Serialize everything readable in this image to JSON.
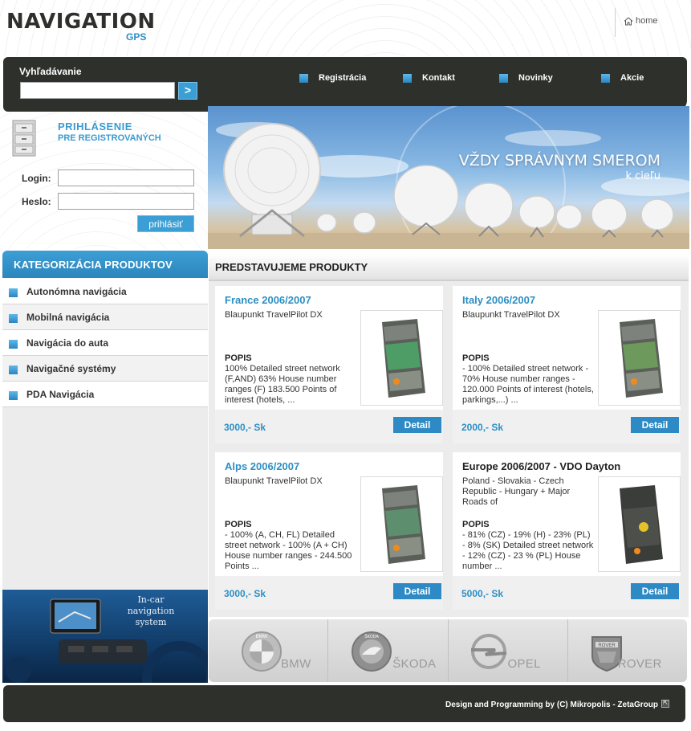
{
  "header": {
    "logo_title": "NAVIGATION",
    "logo_sub": "GPS",
    "home_label": "home"
  },
  "search": {
    "label": "Vyhľadávanie",
    "value": "",
    "placeholder": "",
    "button_label": ">"
  },
  "topnav": {
    "items": [
      {
        "label": "Registrácia"
      },
      {
        "label": "Kontakt"
      },
      {
        "label": "Novinky"
      },
      {
        "label": "Akcie"
      }
    ]
  },
  "login": {
    "title": "PRIHLÁSENIE",
    "subtitle": "PRE REGISTROVANÝCH",
    "login_label": "Login:",
    "password_label": "Heslo:",
    "login_value": "",
    "password_value": "",
    "button_label": "prihlásiť"
  },
  "banner": {
    "title": "VŽDY SPRÁVNYM SMEROM",
    "subtitle": "k cieľu"
  },
  "categories": {
    "title": "KATEGORIZÁCIA PRODUKTOV",
    "items": [
      {
        "label": "Autonómna navigácia"
      },
      {
        "label": "Mobilná navigácia"
      },
      {
        "label": "Navigácia do auta"
      },
      {
        "label": "Navigačné systémy"
      },
      {
        "label": "PDA Navigácia"
      }
    ]
  },
  "incar": {
    "line1": "In-car",
    "line2": "navigation",
    "line3": "system"
  },
  "products": {
    "title": "PREDSTAVUJEME PRODUKTY",
    "items": [
      {
        "title": "France 2006/2007",
        "subtitle": "Blaupunkt TravelPilot DX",
        "popis_label": "POPIS",
        "description": "100% Detailed street network (F,AND) 63% House number ranges (F) 183.500 Points of interest (hotels, ...",
        "price": "3000,- Sk",
        "button_label": "Detail"
      },
      {
        "title": "Italy 2006/2007",
        "subtitle": "Blaupunkt TravelPilot DX",
        "popis_label": "POPIS",
        "description": "- 100% Detailed street network - 70% House number ranges - 120.000 Points of interest (hotels, parkings,...) ...",
        "price": "2000,- Sk",
        "button_label": "Detail"
      },
      {
        "title": "Alps 2006/2007",
        "subtitle": "Blaupunkt TravelPilot DX",
        "popis_label": "POPIS",
        "description": "- 100% (A, CH, FL) Detailed street network - 100% (A + CH) House number ranges - 244.500 Points ...",
        "price": "3000,- Sk",
        "button_label": "Detail"
      },
      {
        "title": "Europe 2006/2007 - VDO Dayton",
        "subtitle": "Poland - Slovakia - Czech Republic - Hungary + Major Roads of",
        "popis_label": "POPIS",
        "description": "- 81% (CZ) - 19% (H) - 23% (PL) - 8% (SK) Detailed street network - 12% (CZ) - 23 % (PL) House number ...",
        "price": "5000,- Sk",
        "button_label": "Detail"
      }
    ]
  },
  "brands": {
    "items": [
      {
        "name": "BMW",
        "logo_text": "BMW"
      },
      {
        "name": "ŠKODA",
        "logo_text": "ŠKODA"
      },
      {
        "name": "OPEL",
        "logo_text": ""
      },
      {
        "name": "ROVER",
        "logo_text": "ROVER"
      }
    ]
  },
  "footer": {
    "text": "Design and Programming by (C) Mikropolis - ZetaGroup"
  },
  "colors": {
    "accent": "#2d8fc4",
    "dark_bar": "#2e302c",
    "button": "#3b9fd6"
  }
}
